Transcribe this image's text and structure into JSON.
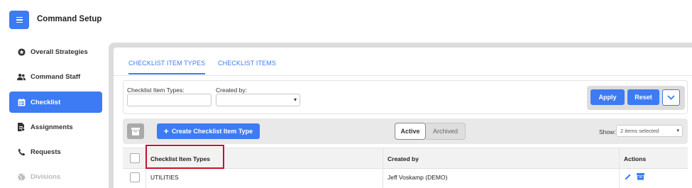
{
  "header": {
    "title": "Command Setup",
    "menu_icon": "hamburger-menu-icon"
  },
  "sidebar": {
    "items": [
      {
        "label": "Overall Strategies",
        "icon": "star-circle-icon",
        "state": "normal"
      },
      {
        "label": "Command Staff",
        "icon": "users-icon",
        "state": "normal"
      },
      {
        "label": "Checklist",
        "icon": "checklist-icon",
        "state": "active"
      },
      {
        "label": "Assignments",
        "icon": "assignment-doc-icon",
        "state": "normal"
      },
      {
        "label": "Requests",
        "icon": "phone-icon",
        "state": "normal"
      },
      {
        "label": "Divisions",
        "icon": "globe-icon",
        "state": "disabled"
      }
    ]
  },
  "tabs": [
    {
      "label": "CHECKLIST ITEM TYPES",
      "active": true
    },
    {
      "label": "CHECKLIST ITEMS",
      "active": false
    }
  ],
  "filters": {
    "item_types_label": "Checklist Item Types:",
    "item_types_value": "",
    "created_by_label": "Created by:",
    "created_by_value": "",
    "apply_label": "Apply",
    "reset_label": "Reset"
  },
  "toolbar": {
    "create_label": "Create Checklist Item Type",
    "segment_active": "Active",
    "segment_archived": "Archived",
    "show_label": "Show:",
    "show_value": "2 items selected"
  },
  "table": {
    "columns": [
      "Checklist Item Types",
      "Created by",
      "Actions"
    ],
    "rows": [
      {
        "type": "UTILITIES",
        "created_by": "Jeff Voskamp (DEMO)"
      }
    ]
  },
  "colors": {
    "accent": "#3d7bf4",
    "highlight": "#c8102e",
    "background": "#dcdcdc"
  }
}
